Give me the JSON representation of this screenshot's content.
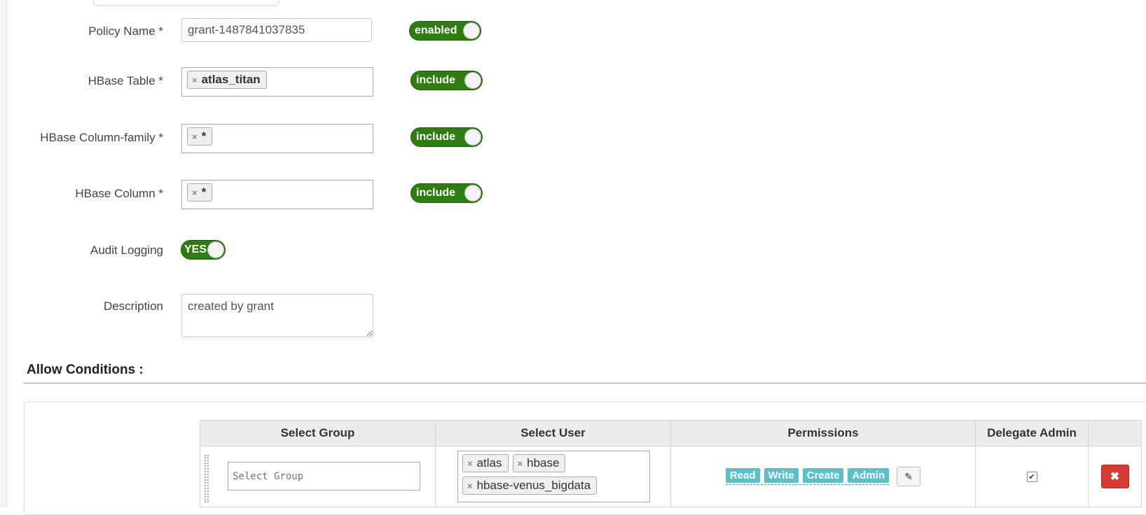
{
  "form": {
    "policy_name": {
      "label": "Policy Name *",
      "value": "grant-1487841037835",
      "toggle": "enabled"
    },
    "hbase_table": {
      "label": "HBase Table *",
      "tags": [
        "atlas_titan"
      ],
      "toggle": "include"
    },
    "hbase_column_family": {
      "label": "HBase Column-family *",
      "tags": [
        "*"
      ],
      "toggle": "include"
    },
    "hbase_column": {
      "label": "HBase Column *",
      "tags": [
        "*"
      ],
      "toggle": "include"
    },
    "audit_logging": {
      "label": "Audit Logging",
      "toggle": "YES"
    },
    "description": {
      "label": "Description",
      "value": "created by grant"
    }
  },
  "allow_conditions": {
    "title": "Allow Conditions :",
    "columns": [
      "Select Group",
      "Select User",
      "Permissions",
      "Delegate Admin"
    ],
    "rows": [
      {
        "group_placeholder": "Select Group",
        "users": [
          "atlas",
          "hbase",
          "hbase-venus_bigdata"
        ],
        "permissions": [
          "Read",
          "Write",
          "Create",
          "Admin"
        ],
        "delegate_admin": true
      }
    ]
  },
  "icons": {
    "tag_remove": "×",
    "edit": "✎",
    "check": "✔",
    "delete": "✖"
  },
  "colors": {
    "toggle_on": "#2f7d12",
    "permission_badge": "#5bc0c8",
    "delete_button": "#d33b35",
    "section_rule": "#7bb35a"
  }
}
